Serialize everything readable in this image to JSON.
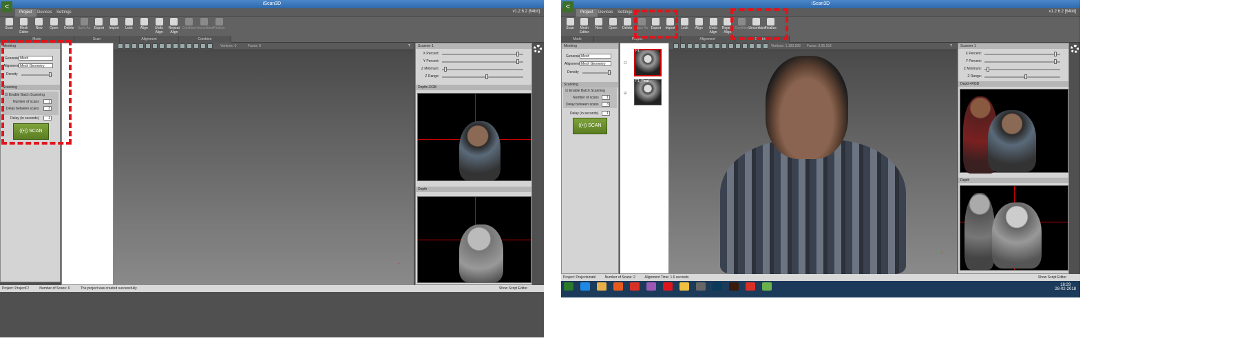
{
  "left": {
    "title": "iScan3D",
    "version": "v1.2.6.2 [64bit]",
    "tabs": [
      "Project",
      "Devices",
      "Settings"
    ],
    "ribbon": [
      {
        "label": "Scan",
        "icon": "wifi-scan-icon",
        "enabled": true
      },
      {
        "label": "Mesh Editor",
        "icon": "mesh-editor-icon",
        "enabled": true
      },
      {
        "label": "New",
        "icon": "new-icon",
        "enabled": true
      },
      {
        "label": "Open",
        "icon": "open-icon",
        "enabled": true
      },
      {
        "label": "Delete",
        "icon": "delete-icon",
        "enabled": true
      },
      {
        "label": "Save As",
        "icon": "save-as-icon",
        "enabled": false
      },
      {
        "label": "Export",
        "icon": "export-icon",
        "enabled": true
      },
      {
        "label": "Import",
        "icon": "import-icon",
        "enabled": true
      },
      {
        "label": "Lock",
        "icon": "lock-icon",
        "enabled": true
      },
      {
        "label": "Align",
        "icon": "align-icon",
        "enabled": true
      },
      {
        "label": "Undo Align",
        "icon": "undo-align-icon",
        "enabled": true
      },
      {
        "label": "Repeat Align",
        "icon": "repeat-align-icon",
        "enabled": true
      },
      {
        "label": "Combine",
        "icon": "combine-icon",
        "enabled": false
      },
      {
        "label": "Uncombine",
        "icon": "uncombine-icon",
        "enabled": false
      },
      {
        "label": "Finalize",
        "icon": "finalize-icon",
        "enabled": false
      }
    ],
    "groups": [
      "Mode",
      "Scan",
      "Alignment",
      "Combine"
    ],
    "toolbar": {
      "vertices": "Vertices: 0",
      "faces": "Faces: 0"
    },
    "meshing": {
      "header": "Meshing",
      "generate_label": "Generate",
      "generate_value": "Mesh",
      "alignment_label": "Alignment",
      "alignment_value": "Mesh Geometry",
      "density_label": "Density",
      "density_level": 0.9
    },
    "scanning": {
      "header": "Scanning",
      "batch_label": "Enable Batch Scanning",
      "num_scans_label": "Number of scans",
      "num_scans": "1",
      "delay_between_label": "Delay between scans",
      "delay_between": "3",
      "delay_label": "Delay (in seconds)",
      "delay": "1",
      "scan_button": "SCAN"
    },
    "scanner": {
      "header": "Scanner 1",
      "sliders": [
        {
          "label": "X Percent:",
          "level": 0.95
        },
        {
          "label": "Y Percent:",
          "level": 0.95
        },
        {
          "label": "Z Minimum:",
          "level": 0.03
        },
        {
          "label": "Z Range:",
          "level": 0.55
        }
      ],
      "rgb_tab": "Depth+RGB",
      "depth_tab": "Depth"
    },
    "status": {
      "project": "Project: ProjectC!",
      "scans": "Number of Scans: 0",
      "message": "The project was created successfully.",
      "script": "Show Script Editor"
    }
  },
  "right": {
    "title": "iScan3D",
    "version": "v1.2.6.2 [64bit]",
    "tabs": [
      "Project",
      "Devices",
      "Settings"
    ],
    "ribbon": [
      {
        "label": "Scan",
        "icon": "wifi-scan-icon",
        "enabled": true
      },
      {
        "label": "Mesh Editor",
        "icon": "mesh-editor-icon",
        "enabled": true
      },
      {
        "label": "New",
        "icon": "new-icon",
        "enabled": true
      },
      {
        "label": "Open",
        "icon": "open-icon",
        "enabled": true
      },
      {
        "label": "Delete",
        "icon": "delete-icon",
        "enabled": true
      },
      {
        "label": "Save As",
        "icon": "save-as-icon",
        "enabled": false
      },
      {
        "label": "Export",
        "icon": "export-icon",
        "enabled": true
      },
      {
        "label": "Import",
        "icon": "import-icon",
        "enabled": true
      },
      {
        "label": "Lock",
        "icon": "lock-icon",
        "enabled": true
      },
      {
        "label": "Align",
        "icon": "align-icon",
        "enabled": true
      },
      {
        "label": "Undo Align",
        "icon": "undo-align-icon",
        "enabled": true
      },
      {
        "label": "Repeat Align",
        "icon": "repeat-align-icon",
        "enabled": true
      },
      {
        "label": "Combine",
        "icon": "combine-icon",
        "enabled": false
      },
      {
        "label": "Uncombine",
        "icon": "uncombine-icon",
        "enabled": true
      },
      {
        "label": "Finalize",
        "icon": "finalize-icon",
        "enabled": true
      }
    ],
    "groups": [
      "Mode",
      "Project",
      "Alignment",
      "Combine"
    ],
    "toolbar": {
      "vertices": "Vertices: 1,193,993",
      "faces": "Faces: 3,95,152"
    },
    "scans": [
      {
        "label": "F1"
      },
      {
        "label": "F1_Final"
      }
    ],
    "meshing": {
      "header": "Meshing",
      "generate_label": "Generate",
      "generate_value": "Mesh",
      "alignment_label": "Alignment",
      "alignment_value": "Mesh Geometry",
      "density_label": "Density",
      "density_level": 0.9
    },
    "scanning": {
      "header": "Scanning",
      "batch_label": "Enable Batch Scanning",
      "num_scans_label": "Number of scans",
      "num_scans": "1",
      "delay_between_label": "Delay between scans",
      "delay_between": "3",
      "delay_label": "Delay (in seconds)",
      "delay": "1",
      "scan_button": "SCAN"
    },
    "scanner": {
      "header": "Scanner 1",
      "sliders": [
        {
          "label": "X Percent:",
          "level": 0.95
        },
        {
          "label": "Y Percent:",
          "level": 0.95
        },
        {
          "label": "Z Minimum:",
          "level": 0.03
        },
        {
          "label": "Z Range:",
          "level": 0.55
        }
      ],
      "rgb_tab": "Depth+RGB",
      "depth_tab": "Depth"
    },
    "status": {
      "project": "Project: Projects/nabl",
      "scans": "Number of Scans: 2",
      "align_time": "Alignment Time: 1.6 seconds",
      "script": "Show Script Editor"
    },
    "clock": {
      "time": "18:29",
      "date": "28-02-2018"
    },
    "taskbar_icons": [
      "start-icon",
      "ie-icon",
      "explorer-icon",
      "firefox-icon",
      "chrome-icon",
      "app-icon",
      "opera-icon",
      "media-icon",
      "tool-icon",
      "photoshop-icon",
      "illustrator-icon",
      "chrome2-icon",
      "iscan-icon"
    ]
  },
  "colors": {
    "highlight": "#e0141b",
    "scan_green": "#6b8f2c"
  }
}
